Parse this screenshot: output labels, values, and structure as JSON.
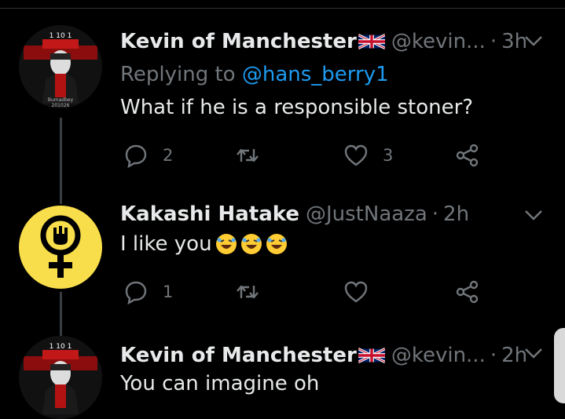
{
  "tweets": [
    {
      "name": "Kevin of Manchester",
      "flag": "uk-flag",
      "handle": "@kevin...",
      "time": "3h",
      "replying_label": "Replying to",
      "replying_to": "@hans_berry1",
      "text": "What if he is a responsible stoner?",
      "avatar_caption": [
        "Bumadbey",
        "201026"
      ],
      "avatar_top_text": "1 10 1",
      "reply_count": "2",
      "retweet_count": "",
      "like_count": "3"
    },
    {
      "name": "Kakashi Hatake",
      "handle": "@JustNaaza",
      "time": "2h",
      "text": "I like you",
      "emojis": [
        "rolling-laughing-emoji",
        "rolling-laughing-emoji",
        "rolling-laughing-emoji"
      ],
      "reply_count": "1",
      "retweet_count": "",
      "like_count": ""
    },
    {
      "name": "Kevin of Manchester",
      "flag": "uk-flag",
      "handle": "@kevin...",
      "time": "2h",
      "text": "You can imagine oh",
      "avatar_top_text": "1 10 1"
    }
  ],
  "colors": {
    "background": "#000000",
    "text": "#e7e9ea",
    "muted": "#71767b",
    "link": "#1d9bf0",
    "avatar_yellow": "#f9de4b"
  },
  "icons": [
    "reply-icon",
    "retweet-icon",
    "like-icon",
    "share-icon",
    "chevron-down-icon"
  ]
}
